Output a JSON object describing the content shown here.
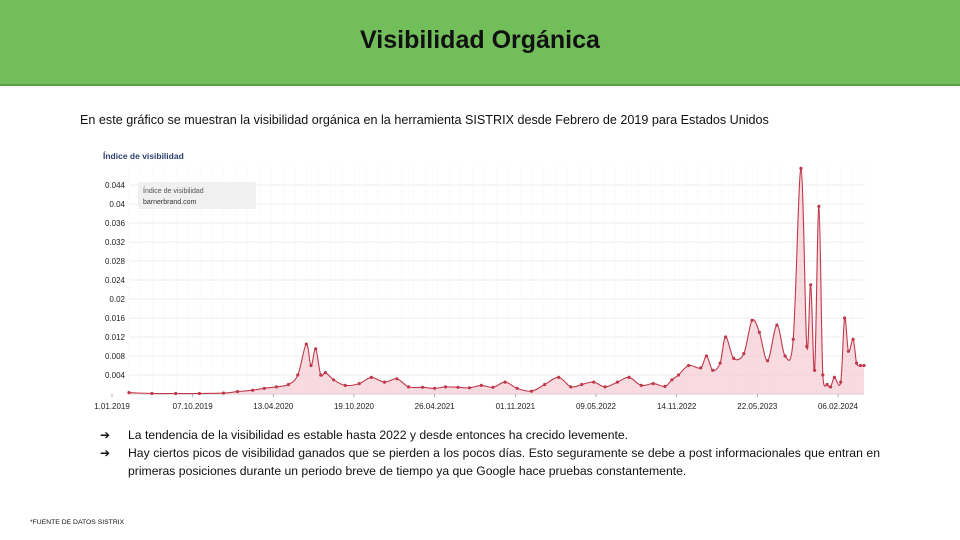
{
  "slide": {
    "title": "Visibilidad Orgánica",
    "intro": "En este gráfico se muestran la visibilidad orgánica en la herramienta SISTRIX desde Febrero de 2019 para Estados Unidos",
    "bullet_icon": "arrow-right-icon",
    "bullets": [
      "La tendencia de la visibilidad es estable hasta 2022 y desde entonces ha crecido levemente.",
      "Hay ciertos picos de visibilidad ganados que se pierden a los pocos días. Esto seguramente se debe a post informacionales que entran en primeras posiciones durante un periodo breve de tiempo ya que Google hace pruebas constantemente."
    ],
    "footer": "*FUENTE DE DATOS SISTRIX"
  },
  "chart_data": {
    "type": "area",
    "title": "Índice de visibilidad",
    "legend": {
      "label": "Índice de visibilidad",
      "domain": "barnerbrand.com",
      "placement": "top-left"
    },
    "x_ticks": [
      "1.01.2019",
      "07.10.2019",
      "13.04.2020",
      "19.10.2020",
      "26.04.2021",
      "01.11.2021",
      "09.05.2022",
      "14.11.2022",
      "22.05.2023",
      "06.02.2024"
    ],
    "y_ticks": [
      "0.044",
      "0.04",
      "0.036",
      "0.032",
      "0.028",
      "0.024",
      "0.02",
      "0.016",
      "0.012",
      "0.008",
      "0.004"
    ],
    "ylim": [
      0,
      0.048
    ],
    "grid": true,
    "colors": {
      "line": "#c0394b",
      "fill": "#f4cfd5",
      "grid": "#e6e6e6"
    },
    "series": [
      {
        "name": "barnerbrand.com",
        "x": [
          "2019-01-01",
          "2019-03-01",
          "2019-05-01",
          "2019-07-01",
          "2019-09-01",
          "2019-10-07",
          "2019-11-15",
          "2019-12-15",
          "2020-01-15",
          "2020-02-15",
          "2020-03-10",
          "2020-04-01",
          "2020-04-13",
          "2020-04-25",
          "2020-05-08",
          "2020-05-20",
          "2020-06-10",
          "2020-07-10",
          "2020-08-15",
          "2020-09-15",
          "2020-10-19",
          "2020-11-20",
          "2020-12-20",
          "2021-01-25",
          "2021-02-25",
          "2021-03-25",
          "2021-04-26",
          "2021-05-25",
          "2021-06-25",
          "2021-07-25",
          "2021-08-25",
          "2021-09-25",
          "2021-11-01",
          "2021-12-05",
          "2022-01-10",
          "2022-02-10",
          "2022-03-10",
          "2022-04-10",
          "2022-05-09",
          "2022-06-10",
          "2022-07-10",
          "2022-08-10",
          "2022-09-10",
          "2022-10-10",
          "2022-10-28",
          "2022-11-14",
          "2022-12-10",
          "2023-01-10",
          "2023-01-25",
          "2023-02-10",
          "2023-03-01",
          "2023-03-15",
          "2023-04-05",
          "2023-05-01",
          "2023-05-22",
          "2023-06-10",
          "2023-07-01",
          "2023-07-25",
          "2023-08-15",
          "2023-09-05",
          "2023-09-25",
          "2023-10-10",
          "2023-10-20",
          "2023-10-30",
          "2023-11-10",
          "2023-11-20",
          "2023-12-01",
          "2023-12-10",
          "2023-12-20",
          "2024-01-05",
          "2024-01-15",
          "2024-01-25",
          "2024-02-06",
          "2024-02-15",
          "2024-02-25",
          "2024-03-05"
        ],
        "values": [
          0.0003,
          0.0001,
          0.0001,
          0.0001,
          0.0002,
          0.0005,
          0.0008,
          0.0012,
          0.0015,
          0.002,
          0.004,
          0.0105,
          0.006,
          0.0095,
          0.004,
          0.0045,
          0.003,
          0.0018,
          0.0022,
          0.0035,
          0.0025,
          0.0032,
          0.0015,
          0.0014,
          0.0012,
          0.0015,
          0.0014,
          0.0013,
          0.0018,
          0.0014,
          0.0025,
          0.0012,
          0.0006,
          0.002,
          0.0035,
          0.0015,
          0.002,
          0.0025,
          0.0015,
          0.0025,
          0.0035,
          0.0018,
          0.0022,
          0.0016,
          0.003,
          0.004,
          0.006,
          0.0055,
          0.008,
          0.005,
          0.0065,
          0.012,
          0.0075,
          0.0085,
          0.0155,
          0.013,
          0.007,
          0.0145,
          0.008,
          0.0115,
          0.0475,
          0.01,
          0.023,
          0.005,
          0.0395,
          0.004,
          0.002,
          0.0015,
          0.0035,
          0.0025,
          0.016,
          0.009,
          0.0115,
          0.0065,
          0.006,
          0.006
        ]
      }
    ]
  }
}
